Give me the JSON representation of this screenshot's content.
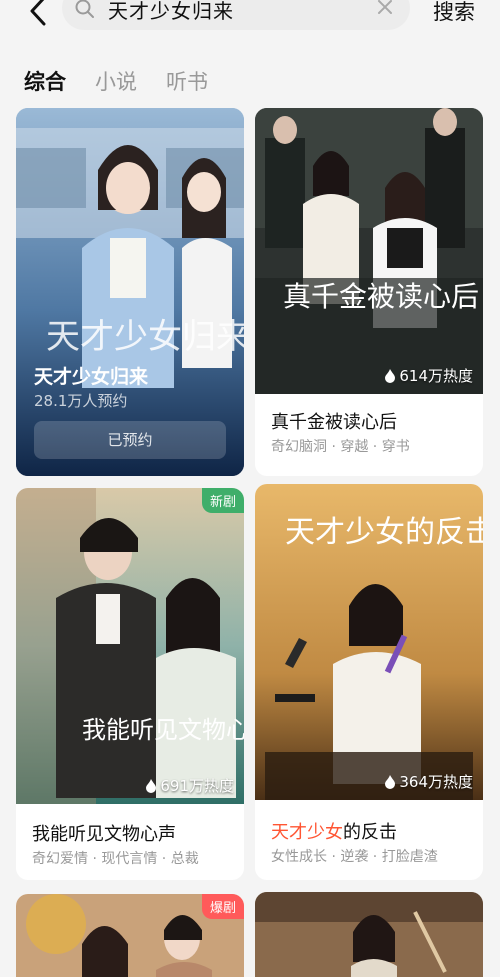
{
  "header": {
    "search_query": "天才少女归来",
    "search_button": "搜索"
  },
  "tabs": [
    {
      "label": "综合",
      "active": true
    },
    {
      "label": "小说",
      "active": false
    },
    {
      "label": "听书",
      "active": false
    }
  ],
  "featured": {
    "title": "天才少女归来",
    "subtitle": "28.1万人预约",
    "button": "已预约",
    "poster_text": "天才少女归来"
  },
  "cards": [
    {
      "title": "真千金被读心后",
      "tags": "奇幻脑洞 · 穿越 · 穿书",
      "heat": "614万热度",
      "poster_text": "真千金被读心后"
    },
    {
      "title": "我能听见文物心声",
      "tags": "奇幻爱情 · 现代言情 · 总裁",
      "heat": "691万热度",
      "badge": "新剧",
      "poster_text": "我能听见文物心声"
    },
    {
      "title_highlight": "天才少女",
      "title_rest": "的反击",
      "tags": "女性成长 · 逆袭 · 打脸虐渣",
      "heat": "364万热度",
      "poster_text": "天才少女的反击"
    },
    {
      "badge": "爆剧"
    }
  ],
  "colors": {
    "accent": "#ff5533",
    "badge_new": "#3fae6a",
    "badge_hot": "#ff5a5a"
  }
}
